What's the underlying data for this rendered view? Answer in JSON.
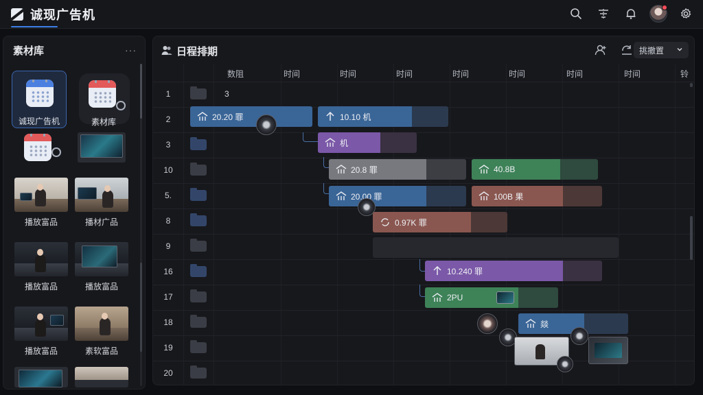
{
  "app": {
    "title": "诚现广告机",
    "accent": "#3d7ee8"
  },
  "topbar": {
    "icons": [
      "search-icon",
      "filter-icon",
      "bell-icon",
      "avatar",
      "gear-icon"
    ]
  },
  "library": {
    "title": "素材库",
    "more": "···",
    "icon_items": [
      {
        "label": "诚现广告机",
        "selected": true
      },
      {
        "label": "素材库",
        "selected": false
      }
    ],
    "thumbs": [
      {
        "label": "播放富品"
      },
      {
        "label": "播材广品"
      },
      {
        "label": "播放富品"
      },
      {
        "label": "播放富品"
      },
      {
        "label": "播放富品"
      },
      {
        "label": "素软富品"
      }
    ]
  },
  "schedule": {
    "title": "日程排期",
    "view_select": "挑撤置",
    "columns": [
      "数阻",
      "时间",
      "时间",
      "时间",
      "时间",
      "时间",
      "时间",
      "时间",
      "铃"
    ],
    "rows": [
      {
        "num": "1",
        "note": "3"
      },
      {
        "num": "2"
      },
      {
        "num": "3"
      },
      {
        "num": "10"
      },
      {
        "num": "5."
      },
      {
        "num": "8"
      },
      {
        "num": "9"
      },
      {
        "num": "16"
      },
      {
        "num": "17"
      },
      {
        "num": "18"
      },
      {
        "num": "19"
      },
      {
        "num": "20"
      }
    ],
    "bars": [
      {
        "label": "20.20 罪",
        "color": "#3a6597",
        "progress": 1.0
      },
      {
        "label": "10.10 机",
        "color": "#3a6597",
        "progress": 0.72
      },
      {
        "label": "机",
        "color": "#7b58a8",
        "progress": 0.63
      },
      {
        "label": "20.8 罪",
        "color": "#77797f",
        "progress": 0.71
      },
      {
        "label": "40.8B",
        "color": "#3e8258",
        "progress": 0.7
      },
      {
        "label": "20.00 罪",
        "color": "#3a6597",
        "progress": 0.71
      },
      {
        "label": "100B 果",
        "color": "#8a5750",
        "progress": 0.7
      },
      {
        "label": "0.97K 罪",
        "color": "#8a5750",
        "progress": 0.73
      },
      {
        "label": "10.240 罪",
        "color": "#7b58a8",
        "progress": 0.78
      },
      {
        "label": "2PU",
        "color": "#3e8258",
        "progress": 0.7
      },
      {
        "label": "燚",
        "color": "#3a6597",
        "progress": 0.6
      }
    ]
  }
}
